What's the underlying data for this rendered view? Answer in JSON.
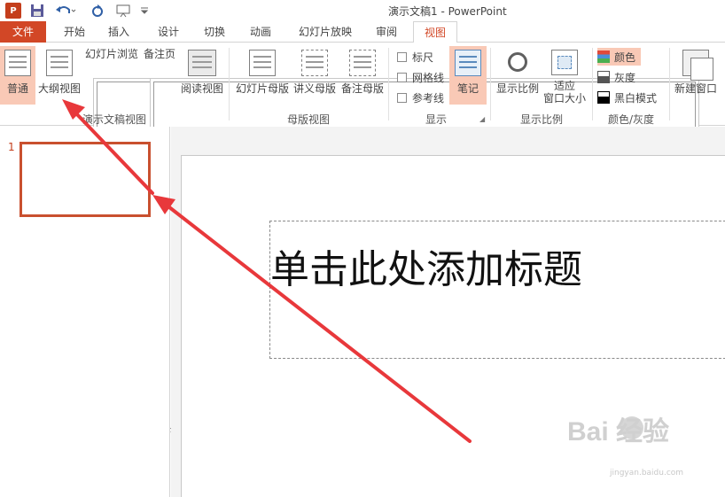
{
  "titlebar": {
    "app_logo": "P",
    "title": "演示文稿1 - PowerPoint",
    "qat_icons": [
      "save-icon",
      "undo-icon",
      "redo-icon",
      "presentation-icon",
      "customize-icon"
    ]
  },
  "tabs": [
    {
      "label": "文件"
    },
    {
      "label": "开始"
    },
    {
      "label": "插入"
    },
    {
      "label": "设计"
    },
    {
      "label": "切换"
    },
    {
      "label": "动画"
    },
    {
      "label": "幻灯片放映"
    },
    {
      "label": "审阅"
    },
    {
      "label": "视图",
      "active": true
    }
  ],
  "ribbon": {
    "presentation_views": {
      "label": "演示文稿视图",
      "buttons": [
        "普通",
        "大纲视图",
        "幻灯片浏览",
        "备注页",
        "阅读视图"
      ]
    },
    "master_views": {
      "label": "母版视图",
      "buttons": [
        "幻灯片母版",
        "讲义母版",
        "备注母版"
      ]
    },
    "show": {
      "label": "显示",
      "checkboxes": [
        "标尺",
        "网格线",
        "参考线"
      ],
      "notes_button": "笔记"
    },
    "zoom": {
      "label": "显示比例",
      "buttons": [
        "显示比例",
        "适应",
        "窗口大小"
      ]
    },
    "color": {
      "label": "颜色/灰度",
      "options": [
        "颜色",
        "灰度",
        "黑白模式"
      ]
    },
    "window": {
      "buttons": [
        "新建窗口"
      ]
    }
  },
  "thumbnails": {
    "slide_number": "1"
  },
  "slide": {
    "title_placeholder": "单击此处添加标题"
  },
  "watermark": {
    "text": "Bai  经验",
    "sub": "jingyan.baidu.com"
  },
  "colors": {
    "accent": "#d24726",
    "selected": "#f9c9b6",
    "arrow": "#e8383b"
  }
}
